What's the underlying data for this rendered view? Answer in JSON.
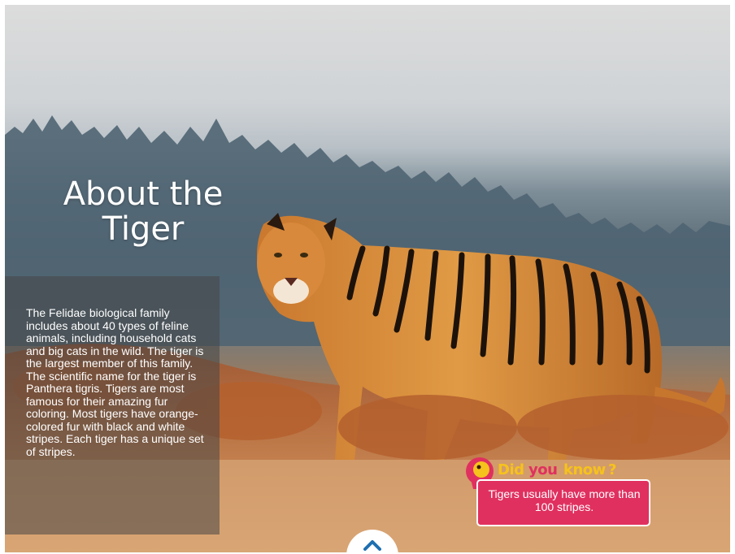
{
  "page": {
    "title": "About the Tiger",
    "body": "The Felidae biological family includes about 40 types of feline animals, including household cats and big cats in the wild. The tiger is the largest member of this family. The scientific name for the tiger is Panthera tigris. Tigers are most famous for their amazing fur coloring. Most tigers have orange-colored fur with black and white stripes. Each tiger has a unique set of stripes."
  },
  "did_you_know": {
    "label_did": "Did",
    "label_you": "you",
    "label_know": "know",
    "label_q": "?",
    "fact": "Tigers usually have more than 100 stripes."
  },
  "nav": {
    "up_icon": "chevron-up-icon"
  },
  "colors": {
    "panel": "#464646",
    "badge": "#e0305f",
    "did": "#f6c21c",
    "you": "#e0305f",
    "know": "#f6c21c"
  }
}
